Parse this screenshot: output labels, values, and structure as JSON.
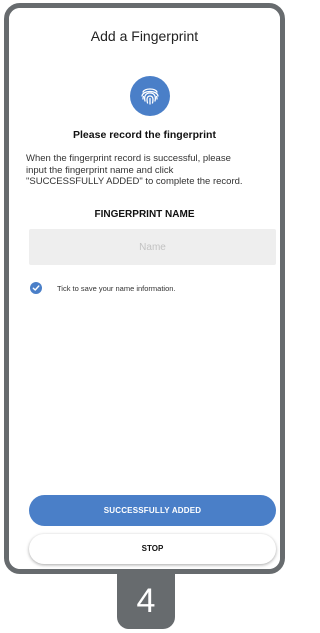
{
  "header": {
    "title": "Add a Fingerprint"
  },
  "record": {
    "icon": "fingerprint-icon",
    "heading": "Please record the fingerprint",
    "instructions_lines": [
      "When the fingerprint record is successful, please",
      "input the fingerprint name and click",
      "\"SUCCESSFULLY ADDED\"  to complete the record."
    ]
  },
  "name_section": {
    "heading": "FINGERPRINT NAME",
    "input_value": "",
    "input_placeholder": "Name"
  },
  "save_option": {
    "checked": true,
    "icon": "check-circle-icon",
    "label": "Tick to save your name information."
  },
  "buttons": {
    "success_label": "SUCCESSFULLY ADDED",
    "stop_label": "STOP"
  },
  "step": {
    "number": "4"
  },
  "colors": {
    "accent": "#4a7fc8",
    "frame": "#676b6e",
    "input_bg": "#eeeeee"
  }
}
